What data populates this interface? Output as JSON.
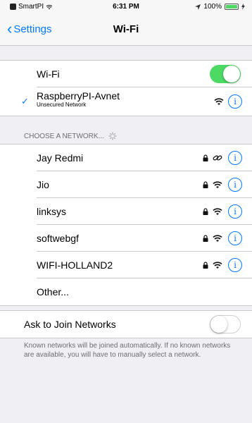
{
  "status_bar": {
    "carrier": "SmartPI",
    "time": "6:31 PM",
    "battery_text": "100%",
    "battery_level": 1.0,
    "icons": [
      "carrier-icon",
      "signal-wifi-icon",
      "location-arrow-icon",
      "battery-icon",
      "charging-icon"
    ]
  },
  "navbar": {
    "back_label": "Settings",
    "title": "Wi-Fi"
  },
  "wifi_toggle": {
    "label": "Wi-Fi",
    "on": true
  },
  "connected_network": {
    "name": "RaspberryPI-Avnet",
    "subtitle": "Unsecured Network",
    "secured": false
  },
  "choose_section": {
    "header": "CHOOSE A NETWORK...",
    "networks": [
      {
        "name": "Jay Redmi",
        "secured": true,
        "signal_icon": "hotspot-link-icon"
      },
      {
        "name": "Jio",
        "secured": true,
        "signal_icon": "wifi-icon"
      },
      {
        "name": "linksys",
        "secured": true,
        "signal_icon": "wifi-icon"
      },
      {
        "name": "softwebgf",
        "secured": true,
        "signal_icon": "wifi-icon"
      },
      {
        "name": "WIFI-HOLLAND2",
        "secured": true,
        "signal_icon": "wifi-icon"
      }
    ],
    "other_label": "Other..."
  },
  "ask_to_join": {
    "label": "Ask to Join Networks",
    "on": false,
    "footer": "Known networks will be joined automatically. If no known networks are available, you will have to manually select a network."
  },
  "colors": {
    "accent": "#007aff",
    "toggle_on": "#4cd964",
    "background": "#efeff4",
    "separator": "#c8c7cc",
    "secondary_text": "#6d6d72"
  }
}
